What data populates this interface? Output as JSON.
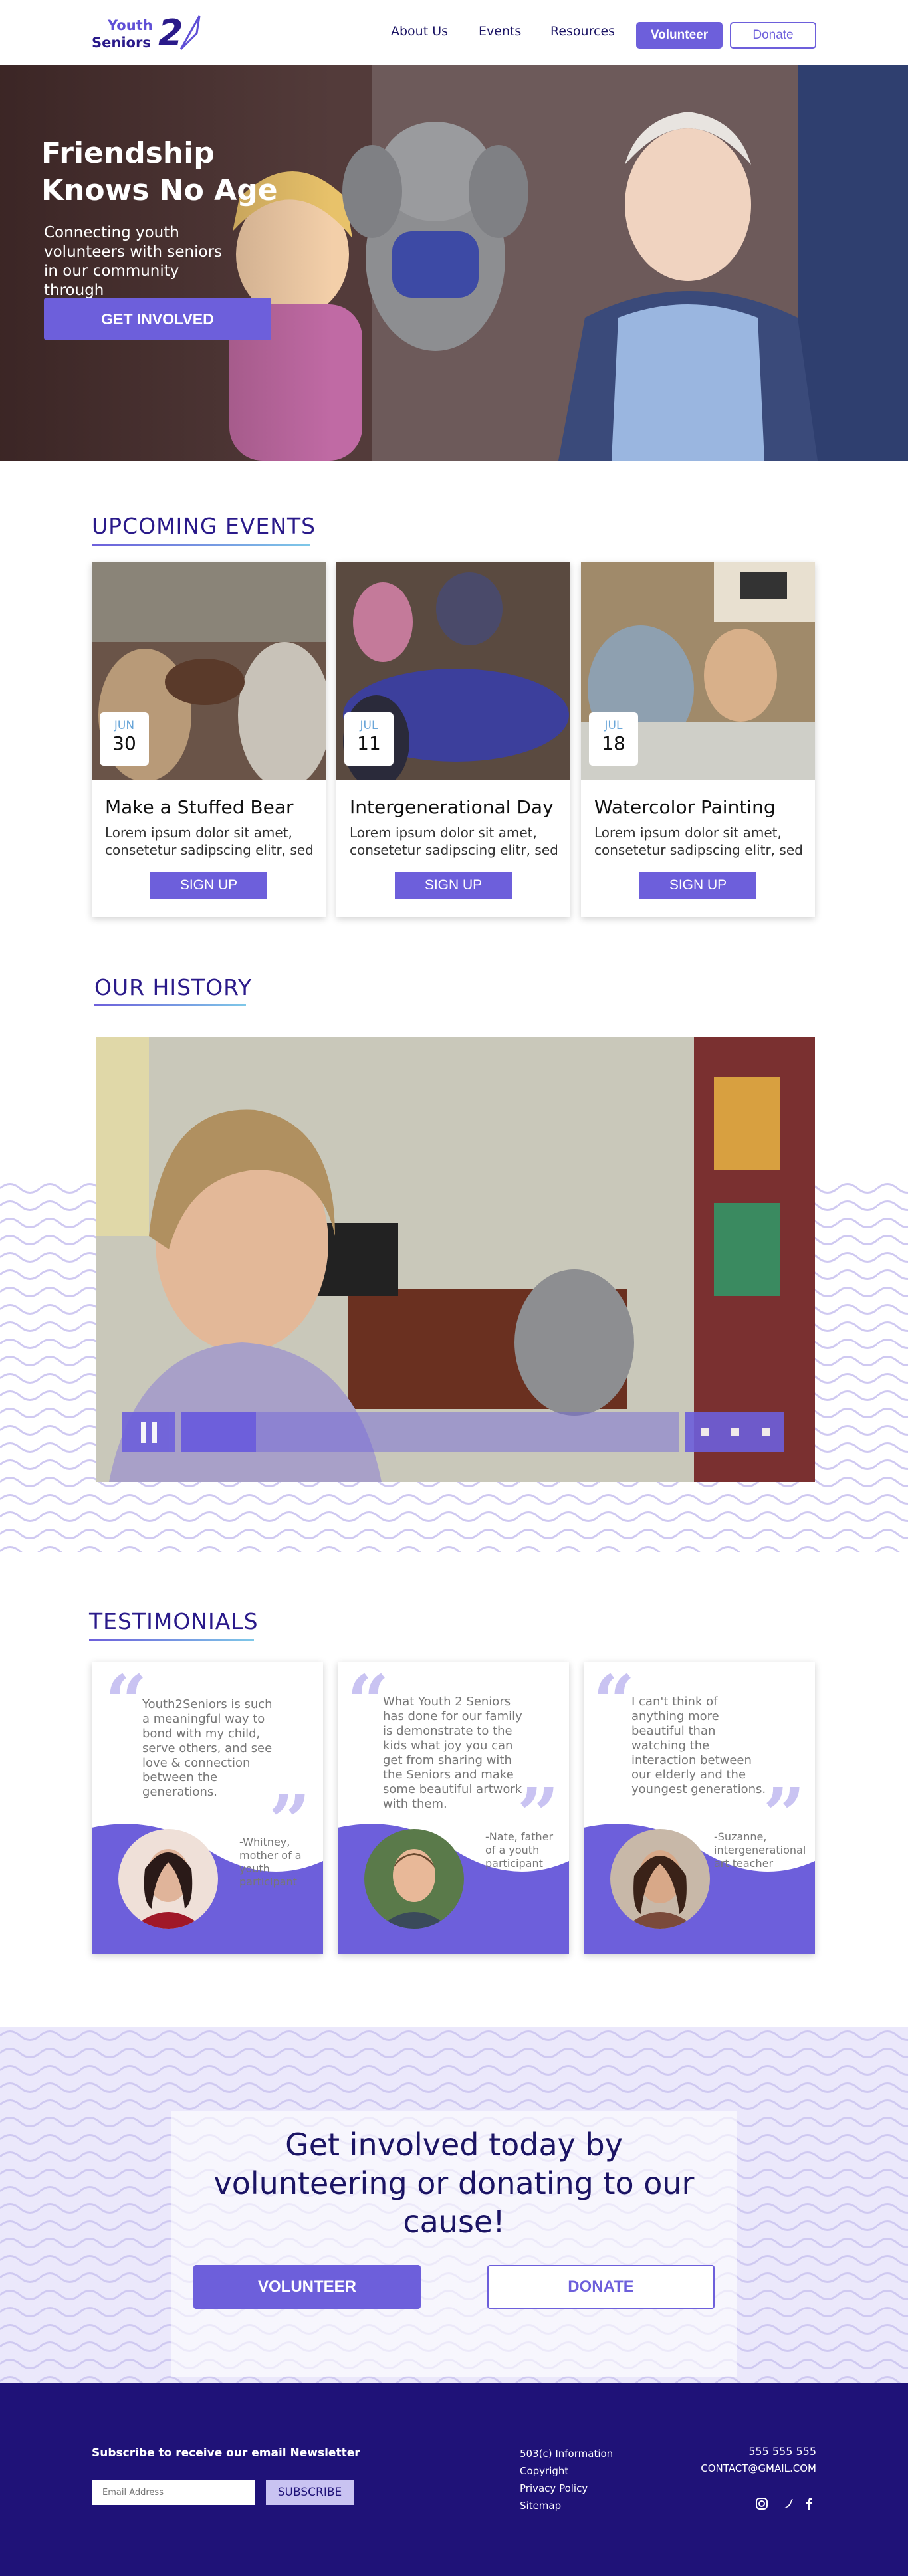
{
  "header": {
    "logo_line1": "Youth",
    "logo_line2": "Seniors",
    "logo_numeral": "2",
    "nav": [
      "About Us",
      "Events",
      "Resources"
    ],
    "volunteer": "Volunteer",
    "donate": "Donate"
  },
  "hero": {
    "title": "Friendship Knows No Age",
    "subtitle": "Connecting youth volunteers with seniors in our community through intergenerational activities",
    "button": "GET INVOLVED"
  },
  "events": {
    "heading": "UPCOMING EVENTS",
    "items": [
      {
        "month": "JUN",
        "day": "30",
        "title": "Make a Stuffed Bear",
        "desc": "Lorem ipsum dolor sit amet, consetetur sadipscing elitr, sed",
        "button": "SIGN UP"
      },
      {
        "month": "JUL",
        "day": "11",
        "title": "Intergenerational Day",
        "desc": "Lorem ipsum dolor sit amet, consetetur sadipscing elitr, sed",
        "button": "SIGN UP"
      },
      {
        "month": "JUL",
        "day": "18",
        "title": "Watercolor Painting",
        "desc": "Lorem ipsum dolor sit amet, consetetur sadipscing elitr, sed",
        "button": "SIGN UP"
      }
    ]
  },
  "history": {
    "heading": "OUR HISTORY",
    "video_progress": 0.15
  },
  "testimonials": {
    "heading": "TESTIMONIALS",
    "items": [
      {
        "quote": "Youth2Seniors is such a meaningful way to bond with my child, serve others, and see love & connection between the generations.",
        "author": "-Whitney, mother of a youth participant"
      },
      {
        "quote": "What Youth 2 Seniors has done for our family is demonstrate to the kids what joy you can get from sharing with the Seniors and make some beautiful artwork with them.",
        "author": "-Nate, father of a youth participant"
      },
      {
        "quote": "I can't think of anything more beautiful than watching the interaction between our elderly and the youngest generations.",
        "author": "-Suzanne, intergenerational art teacher"
      }
    ]
  },
  "cta": {
    "text": "Get involved today by volunteering or donating to our cause!",
    "volunteer": "VOLUNTEER",
    "donate": "DONATE"
  },
  "footer": {
    "newsletter_label": "Subscribe to receive our email Newsletter",
    "email_placeholder": "Email Address",
    "subscribe": "SUBSCRIBE",
    "links": [
      "503(c) Information",
      "Copyright",
      "Privacy Policy",
      "Sitemap"
    ],
    "phone": "555 555 555",
    "email": "CONTACT@GMAIL.COM",
    "social_icons": [
      "instagram-icon",
      "twitter-icon",
      "facebook-icon"
    ]
  },
  "colors": {
    "accent": "#6d5fdb",
    "navy": "#1f1278",
    "heading": "#2a1a8a"
  }
}
